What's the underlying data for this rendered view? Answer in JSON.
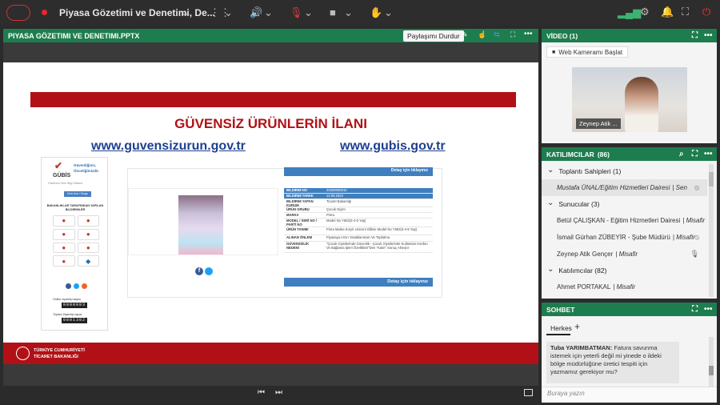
{
  "topbar": {
    "title": "Piyasa Gözetimi ve Denetimi, De...",
    "icons": [
      "logo-icon",
      "record-dot-icon",
      "chevron-down-icon",
      "grid-icon",
      "speaker-icon",
      "mic-muted-icon",
      "camera-icon",
      "raise-hand-icon",
      "signal-icon",
      "settings-icon",
      "bell-icon",
      "fullscreen-icon",
      "power-icon"
    ]
  },
  "share": {
    "title": "PIYASA GÖZETIMI VE DENETIMI.PPTX",
    "stop_label": "Paylaşımı Durdur"
  },
  "slide": {
    "heading": "GÜVENSİZ ÜRÜNLERİN İLANI",
    "link1": "www.guvensizurun.gov.tr",
    "link2": "www.gubis.gov.tr",
    "gubis_logo": "GÜBİS",
    "gubis_tag1": "Güvenliğiniz,",
    "gubis_tag2": "Önceliğimizdir.",
    "gubis_sub": "Güvensiz Ürün Bilgi Sistemi",
    "gubis_btn": "Ürün Ara / Sorgu",
    "gubis_section": "BAKANLIKLAR TARAFINDAN YAPILAN BILDIRIMLER",
    "online_label": "Online ziyaretçi sayısı",
    "online_count": "0000003",
    "total_label": "Toplam Ziyaretçi sayısı",
    "total_count": "0001302",
    "detail_top": "Detay için tıklayınız",
    "detail_bottom": "Detay için tıklayınız",
    "table": [
      {
        "k": "BILDIRIM NO",
        "v": "20250000010"
      },
      {
        "k": "BILDIRIM TARIHI",
        "v": "12.08.2024"
      },
      {
        "k": "BILDIRIM YAPAN KURUM",
        "v": "Ticaret Bakanlığı"
      },
      {
        "k": "ÜRÜN GRUBU",
        "v": "Çocuk Giyim"
      },
      {
        "k": "MARKA",
        "v": "Pinra"
      },
      {
        "k": "MODEL / SERİ NO / PARTİ NO",
        "v": "Model No Y602(3-4-5 Yaş)"
      },
      {
        "k": "ÜRÜN TANIMI",
        "v": "Pinra Marka Kırçık Unicorn Elbise Model No Y602(3-4-5 Yaş)"
      },
      {
        "k": "ALINAN ÖNLEM",
        "v": "Piyasaya Arzın Yasaklanması Ve Toplatma"
      },
      {
        "k": "GÜVENSİZLİK NEDENİ",
        "v": "\"Çocuk Giysilerinde Güvenlik - Çocuk Giysilerinde Kullanılan Kordon Ve Bağlama İpleri Özellikleri\"Den \"Kalın\" Sonuç Almıştır"
      }
    ],
    "footer_line1": "TÜRKİYE CUMHURİYETİ",
    "footer_line2": "TİCARET BAKANLIĞI"
  },
  "video": {
    "title": "VİDEO (1)",
    "webcam_btn": "Web Kameramı Başlat",
    "person_name": "Zeynep Atik ..."
  },
  "participants": {
    "title": "KATILIMCILAR",
    "count": "(86)",
    "groups": [
      {
        "label": "Toplantı Sahipleri (1)",
        "members": [
          {
            "name": "Mustafa ÜNAL/Eğitim Hizmetleri Dairesi",
            "role": "| Sen",
            "italic": true,
            "mic": "mic-muted-icon"
          }
        ]
      },
      {
        "label": "Sunucular (3)",
        "members": [
          {
            "name": "Betül ÇALIŞKAN - Eğitim Hizmetleri Dairesi",
            "role": "| Misafir",
            "italic": false,
            "mic": ""
          },
          {
            "name": "İsmail Gürhan ZÜBEYİR - Şube Müdürü",
            "role": "| Misafir",
            "italic": false,
            "mic": "mic-muted-icon"
          },
          {
            "name": "Zeynep Atik Gençer",
            "role": "| Misafir",
            "italic": false,
            "mic": "mic-icon"
          }
        ]
      },
      {
        "label": "Katılımcılar (82)",
        "members": [
          {
            "name": "Ahmet PORTAKAL",
            "role": "| Misafir",
            "italic": false,
            "mic": ""
          }
        ]
      }
    ]
  },
  "chat": {
    "title": "SOHBET",
    "tab": "Herkes",
    "sender": "Tuba YARIMBATMAN:",
    "message": "Fatura savunma istemek için yeterli değil mi yinede o ildeki bölge müdürlüğüne üretici tespiti için yazmamız gerekiyor mu?",
    "input_placeholder": "Buraya yazın"
  },
  "colors": {
    "brand_green": "#1e7d4f",
    "slide_red": "#b11116",
    "link_blue": "#1f3f8f",
    "table_blue": "#3f7fbf"
  }
}
